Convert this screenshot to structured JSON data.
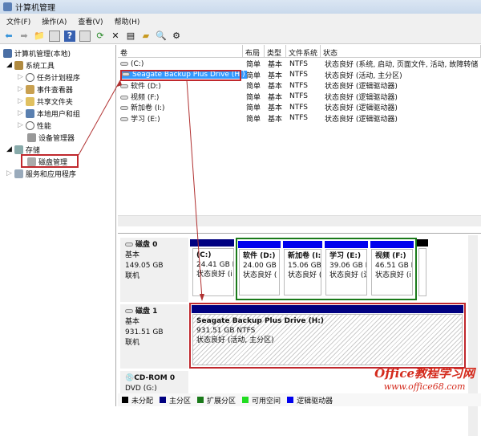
{
  "window": {
    "title": "计算机管理"
  },
  "menu": [
    "文件(F)",
    "操作(A)",
    "查看(V)",
    "帮助(H)"
  ],
  "toolbar": [
    "back-icon",
    "forward-icon",
    "up-icon",
    "show-hide-tree-icon",
    "help-icon",
    "properties-icon",
    "refresh-icon",
    "delete-icon",
    "properties2-icon",
    "open-icon",
    "search-icon",
    "settings-icon"
  ],
  "tree": {
    "root": "计算机管理(本地)",
    "system_tools": "系统工具",
    "task_scheduler": "任务计划程序",
    "event_viewer": "事件查看器",
    "shared_folders": "共享文件夹",
    "local_users": "本地用户和组",
    "performance": "性能",
    "device_manager": "设备管理器",
    "storage": "存储",
    "disk_management": "磁盘管理",
    "services": "服务和应用程序"
  },
  "columns": [
    "卷",
    "布局",
    "类型",
    "文件系统",
    "状态"
  ],
  "volumes": [
    {
      "name": "(C:)",
      "layout": "简单",
      "type": "基本",
      "fs": "NTFS",
      "status": "状态良好 (系统, 启动, 页面文件, 活动, 故障转储"
    },
    {
      "name": "Seagate Backup Plus Drive (H:)",
      "layout": "简单",
      "type": "基本",
      "fs": "NTFS",
      "status": "状态良好 (活动, 主分区)"
    },
    {
      "name": "软件 (D:)",
      "layout": "简单",
      "type": "基本",
      "fs": "NTFS",
      "status": "状态良好 (逻辑驱动器)"
    },
    {
      "name": "视频 (F:)",
      "layout": "简单",
      "type": "基本",
      "fs": "NTFS",
      "status": "状态良好 (逻辑驱动器)"
    },
    {
      "name": "新加卷 (I:)",
      "layout": "简单",
      "type": "基本",
      "fs": "NTFS",
      "status": "状态良好 (逻辑驱动器)"
    },
    {
      "name": "学习 (E:)",
      "layout": "简单",
      "type": "基本",
      "fs": "NTFS",
      "status": "状态良好 (逻辑驱动器)"
    }
  ],
  "disks": [
    {
      "name": "磁盘 0",
      "type": "基本",
      "size": "149.05 GB",
      "state": "联机",
      "partitions": [
        {
          "name": "(C:)",
          "size": "24.41 GB I",
          "status": "状态良好 (i"
        },
        {
          "name": "软件  (D:)",
          "size": "24.00 GB",
          "status": "状态良好 ("
        },
        {
          "name": "新加卷  (I:",
          "size": "15.06 GB",
          "status": "状态良好 ("
        },
        {
          "name": "学习  (E:)",
          "size": "39.06 GB N",
          "status": "状态良好 (逻"
        },
        {
          "name": "视频  (F:)",
          "size": "46.51 GB I",
          "status": "状态良好 (i"
        }
      ]
    },
    {
      "name": "磁盘 1",
      "type": "基本",
      "size": "931.51 GB",
      "state": "联机",
      "partitions": [
        {
          "name": "Seagate Backup Plus Drive  (H:)",
          "size": "931.51 GB NTFS",
          "status": "状态良好 (活动, 主分区)"
        }
      ]
    },
    {
      "name": "CD-ROM 0",
      "type": "DVD (G:)"
    }
  ],
  "legend": [
    {
      "label": "未分配",
      "color": "#000000"
    },
    {
      "label": "主分区",
      "color": "#000080"
    },
    {
      "label": "扩展分区",
      "color": "#1a7a1a"
    },
    {
      "label": "可用空间",
      "color": "#22dd22"
    },
    {
      "label": "逻辑驱动器",
      "color": "#0000ee"
    }
  ],
  "watermark": {
    "line1": "Office教程学习网",
    "line2": "www.office68.com"
  }
}
